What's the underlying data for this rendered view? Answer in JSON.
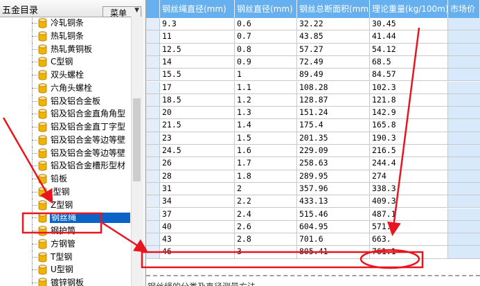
{
  "left_panel": {
    "title": "五金目录",
    "menu_label": "菜单",
    "items": [
      {
        "label": "冷轧铜条"
      },
      {
        "label": "热轧铜条"
      },
      {
        "label": "热轧黄铜板"
      },
      {
        "label": "C型钢"
      },
      {
        "label": "双头螺栓"
      },
      {
        "label": "六角头螺栓"
      },
      {
        "label": "铝及铝合金板"
      },
      {
        "label": "铝及铝合金直角角型"
      },
      {
        "label": "铝及铝合金直丁字型"
      },
      {
        "label": "铝及铝合金等边等壁"
      },
      {
        "label": "铝及铝合金等边等壁"
      },
      {
        "label": "铝及铝合金槽形型材"
      },
      {
        "label": "铅板"
      },
      {
        "label": "I型钢"
      },
      {
        "label": "Z型钢"
      },
      {
        "label": "钢丝绳"
      },
      {
        "label": "钢护筒"
      },
      {
        "label": "方钢管"
      },
      {
        "label": "T型钢"
      },
      {
        "label": "U型钢"
      },
      {
        "label": "镀锌钢板"
      }
    ],
    "selected_index": 15
  },
  "grid": {
    "columns": [
      "钢丝绳直径(mm)",
      "钢丝直径(mm)",
      "钢丝总断面积(mm2)",
      "理论重量(kg/100m)",
      "市场价"
    ],
    "rows": [
      [
        "9.3",
        "0.6",
        "32.22",
        "30.45"
      ],
      [
        "11",
        "0.7",
        "43.85",
        "41.44"
      ],
      [
        "12.5",
        "0.8",
        "57.27",
        "54.12"
      ],
      [
        "14",
        "0.9",
        "72.49",
        "68.5"
      ],
      [
        "15.5",
        "1",
        "89.49",
        "84.57"
      ],
      [
        "17",
        "1.1",
        "108.28",
        "102.3"
      ],
      [
        "18.5",
        "1.2",
        "128.87",
        "121.8"
      ],
      [
        "20",
        "1.3",
        "151.24",
        "142.9"
      ],
      [
        "21.5",
        "1.4",
        "175.4",
        "165.8"
      ],
      [
        "23",
        "1.5",
        "201.35",
        "190.3"
      ],
      [
        "24.5",
        "1.6",
        "229.09",
        "216.5"
      ],
      [
        "26",
        "1.7",
        "258.63",
        "244.4"
      ],
      [
        "28",
        "1.8",
        "289.95",
        "274"
      ],
      [
        "31",
        "2",
        "357.96",
        "338.3"
      ],
      [
        "34",
        "2.2",
        "433.13",
        "409.3"
      ],
      [
        "37",
        "2.4",
        "515.46",
        "487.1"
      ],
      [
        "40",
        "2.6",
        "604.95",
        "571."
      ],
      [
        "43",
        "2.8",
        "701.6",
        "663."
      ],
      [
        "46",
        "3",
        "805.41",
        "761.1"
      ]
    ],
    "highlighted_row": 18,
    "status_text": "钢丝绳的分类及直径测量方法"
  },
  "colors": {
    "header_bg": "#66b0f0",
    "selection_bg": "#0a64c8",
    "annotation_red": "#e8141e"
  }
}
